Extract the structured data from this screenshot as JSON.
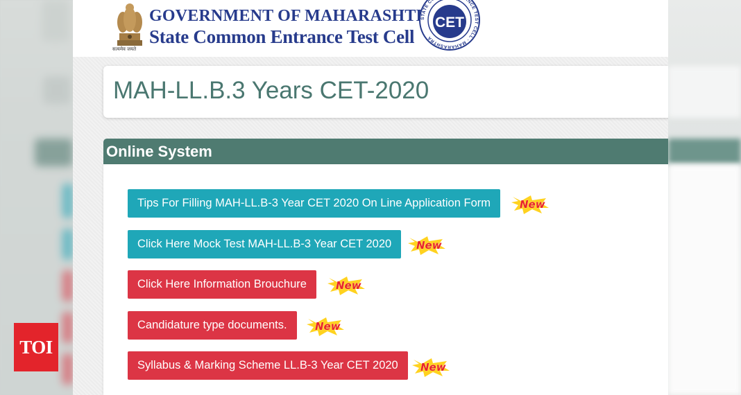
{
  "header": {
    "line1": "GOVERNMENT OF MAHARASHTRA",
    "line2": "State Common Entrance Test Cell",
    "emblem_caption": "सत्यमेव जयते",
    "logo_center": "CET",
    "logo_ring": "STATE COMMON ENTRANCE TEST CELL · MAHARASHTRA"
  },
  "page_title": "MAH-LL.B.3 Years CET-2020",
  "panel": {
    "title": "Online System",
    "links": [
      {
        "label": "Tips For Filling MAH-LL.B-3 Year CET 2020 On Line Application Form",
        "badge": "New",
        "color": "#1fa7b8"
      },
      {
        "label": "Click Here Mock Test MAH-LL.B-3 Year CET 2020",
        "badge": "New",
        "color": "#1fa7b8"
      },
      {
        "label": "Click Here Information Brouchure",
        "badge": "New",
        "color": "#dc3545"
      },
      {
        "label": "Candidature type documents.",
        "badge": "New",
        "color": "#dc3545"
      },
      {
        "label": "Syllabus & Marking Scheme LL.B-3 Year CET 2020",
        "badge": "New",
        "color": "#dc3545"
      }
    ]
  },
  "watermark": {
    "label": "TOI"
  },
  "colors": {
    "header_text": "#273b8c",
    "title_text": "#4a7770",
    "panel_header": "#4f7b71",
    "teal": "#1fa7b8",
    "red": "#dc3545",
    "toi": "#e3242b"
  }
}
